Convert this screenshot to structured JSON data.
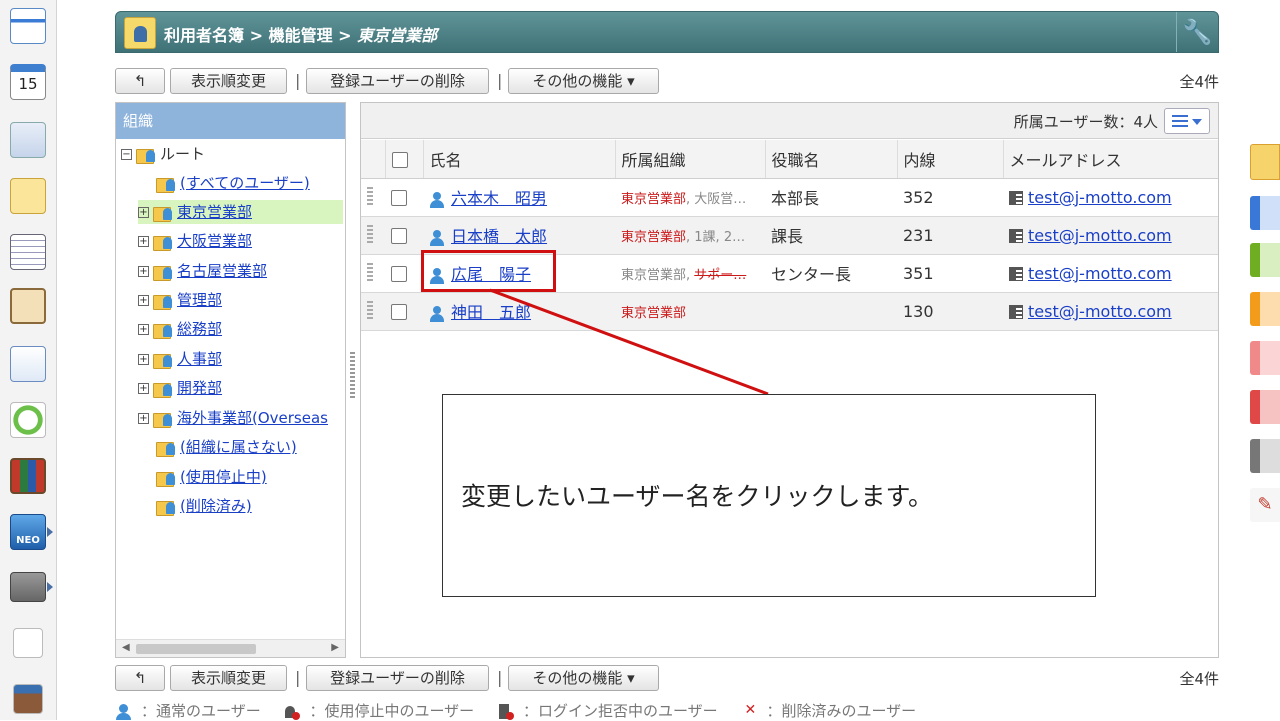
{
  "breadcrumb": {
    "root": "利用者名簿",
    "sep1": " > ",
    "section": "機能管理",
    "sep2": " > ",
    "current": "東京営業部"
  },
  "toolbar": {
    "back_icon": "back-arrow-icon",
    "reorder_label": "表示順変更",
    "delete_users_label": "登録ユーザーの削除",
    "other_label": "その他の機能 ▾",
    "separator": "|",
    "total": "全4件"
  },
  "org_panel": {
    "header": "組織",
    "root": "ルート",
    "items": [
      {
        "label": "(すべてのユーザー)",
        "expandable": false
      },
      {
        "label": "東京営業部",
        "expandable": true,
        "selected": true
      },
      {
        "label": "大阪営業部",
        "expandable": true
      },
      {
        "label": "名古屋営業部",
        "expandable": true
      },
      {
        "label": "管理部",
        "expandable": true
      },
      {
        "label": "総務部",
        "expandable": true
      },
      {
        "label": "人事部",
        "expandable": true
      },
      {
        "label": "開発部",
        "expandable": true
      },
      {
        "label": "海外事業部(Overseas",
        "expandable": true
      },
      {
        "label": "(組織に属さない)",
        "expandable": false
      },
      {
        "label": "(使用停止中)",
        "expandable": false
      },
      {
        "label": "(削除済み)",
        "expandable": false
      }
    ]
  },
  "member_panel": {
    "member_count": "所属ユーザー数：4人",
    "columns": {
      "name": "氏名",
      "org": "所属組織",
      "title": "役職名",
      "ext": "内線",
      "mail": "メールアドレス"
    },
    "rows": [
      {
        "name": "六本木　昭男",
        "org_main": "東京営業部",
        "org_rest": ", 大阪営…",
        "org_rest_style": "gray",
        "title": "本部長",
        "ext": "352",
        "mail": "test@j-motto.com"
      },
      {
        "name": "日本橋　太郎",
        "org_main": "東京営業部",
        "org_rest": ", 1課, 2…",
        "org_rest_style": "gray",
        "title": "課長",
        "ext": "231",
        "mail": "test@j-motto.com"
      },
      {
        "name": "広尾　陽子",
        "org_main": "東京営業部",
        "org_main_style": "gray",
        "org_rest": ", ",
        "org_rest2": "サポー…",
        "org_rest_style": "gray",
        "title": "センター長",
        "ext": "351",
        "mail": "test@j-motto.com"
      },
      {
        "name": "神田　五郎",
        "org_main": "東京営業部",
        "org_rest": "",
        "title": "",
        "ext": "130",
        "mail": "test@j-motto.com"
      }
    ]
  },
  "annotation": {
    "text": "変更したいユーザー名をクリックします。",
    "color": "#d01010"
  },
  "legend": {
    "normal": "：通常のユーザー",
    "suspended": "：使用停止中のユーザー",
    "login_denied": "：ログイン拒否中のユーザー",
    "deleted": "：削除済みのユーザー"
  },
  "colors": {
    "header_teal": "#4f8489",
    "org_header_blue": "#8fb4dc",
    "link_blue": "#1a3fc7",
    "selected_green": "#d8f5c0"
  }
}
